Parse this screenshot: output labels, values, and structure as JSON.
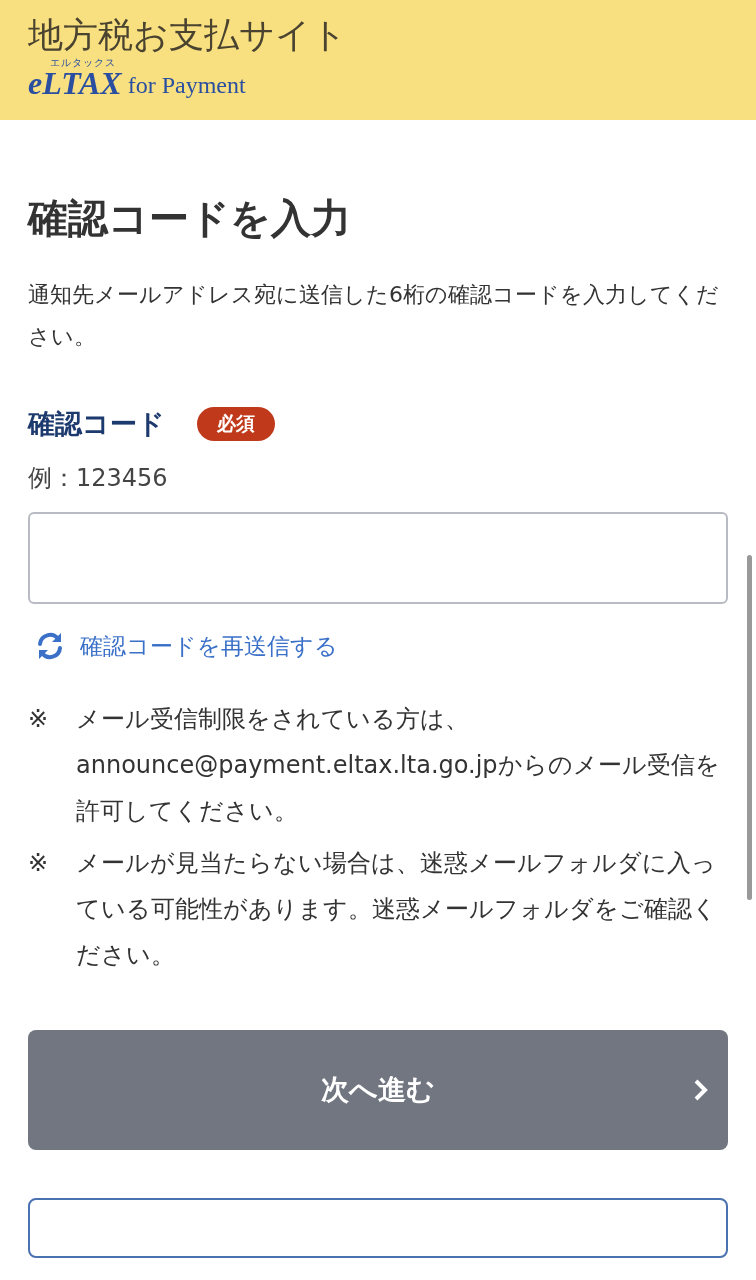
{
  "header": {
    "site_title": "地方税お支払サイト",
    "logo": {
      "kana": "エルタックス",
      "brand": "eLTAX",
      "suffix": "for Payment"
    }
  },
  "page_title": "確認コードを入力",
  "description": "通知先メールアドレス宛に送信した6桁の確認コードを入力してください。",
  "field": {
    "label": "確認コード",
    "badge": "必須",
    "hint": "例：123456"
  },
  "resend_link": "確認コードを再送信する",
  "notes": [
    {
      "mark": "※",
      "text": "メール受信制限をされている方は、announce@payment.eltax.lta.go.jpからのメール受信を許可してください。"
    },
    {
      "mark": "※",
      "text": "メールが見当たらない場合は、迷惑メールフォルダに入っている可能性があります。迷惑メールフォルダをご確認ください。"
    }
  ],
  "next_button": {
    "label": "次へ進む",
    "disabled": true
  }
}
